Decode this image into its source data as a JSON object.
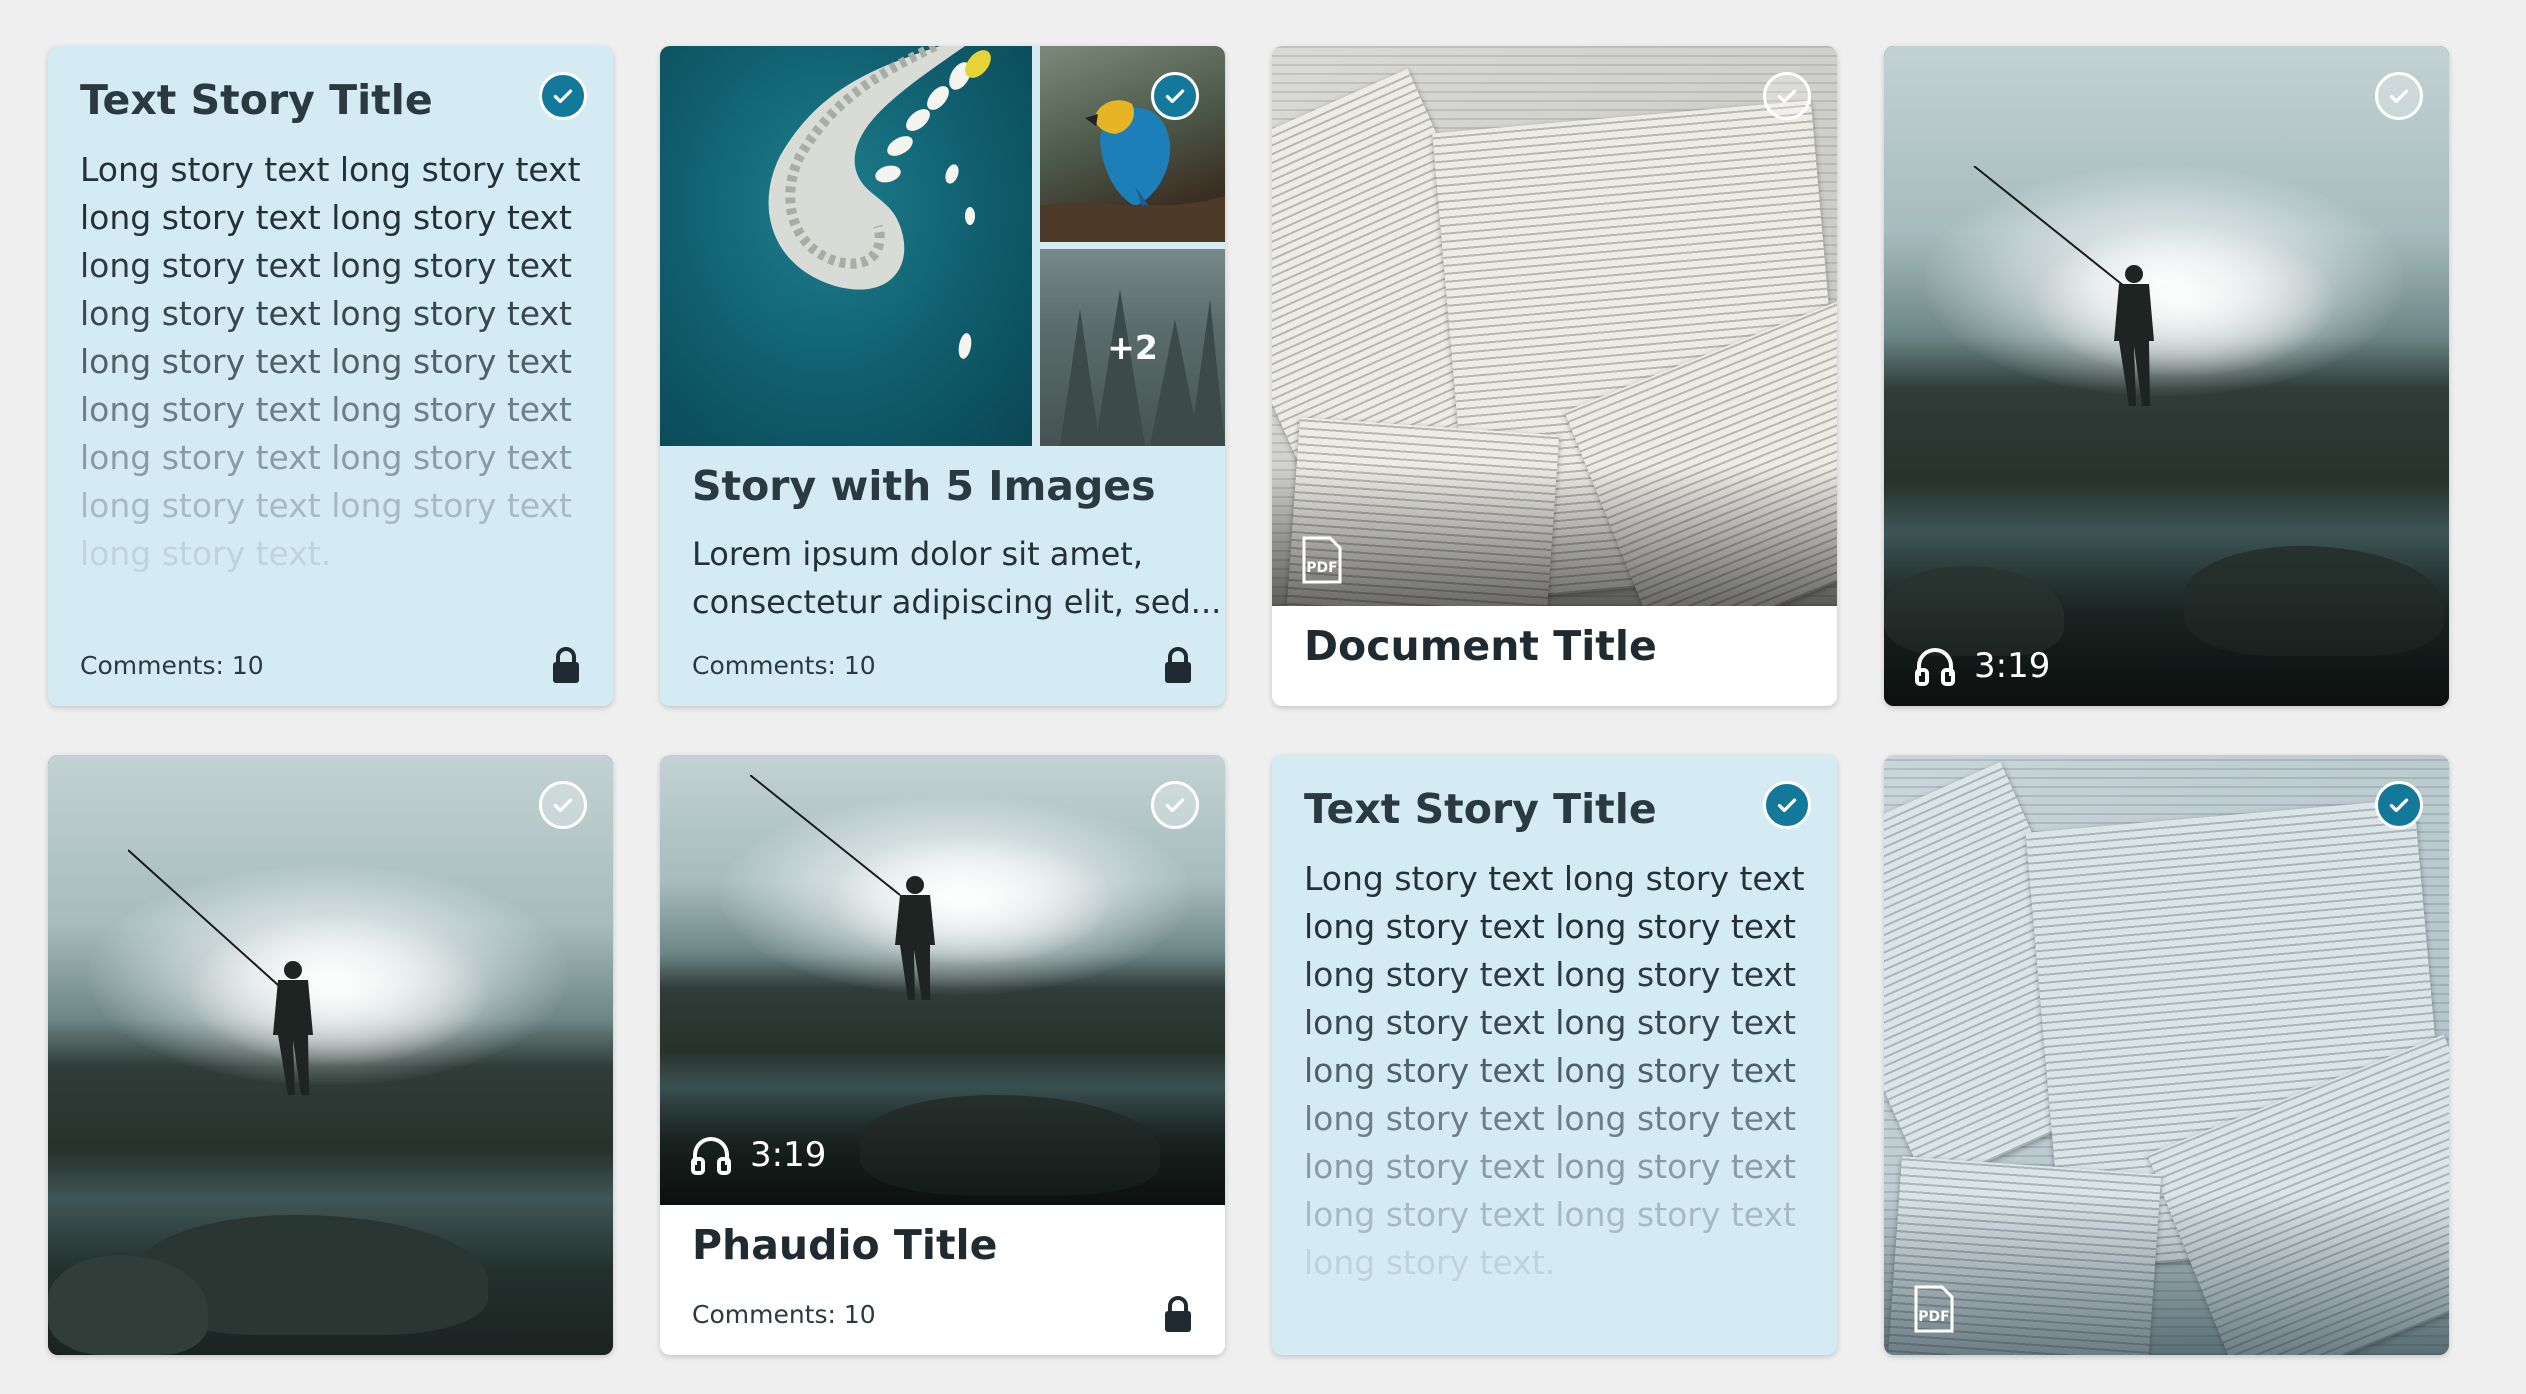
{
  "colors": {
    "accent": "#12799b",
    "card_blue": "#d4ebf4",
    "background": "#efefef"
  },
  "icons": {
    "selected": "check-circle-icon",
    "unselected": "check-circle-outline-icon",
    "lock": "lock-icon",
    "audio": "headphones-icon",
    "document": "pdf-icon"
  },
  "cards": {
    "text_story_1": {
      "title": "Text Story Title",
      "lines": [
        "Long story text long story text",
        "long story text long story text",
        "long story text long story text",
        "long story text long story text",
        "long story text long story text",
        "long story text long story text",
        "long story text long story text",
        "long story text long story text",
        "long story text."
      ],
      "comments": "Comments: 10",
      "selected": true
    },
    "image_story": {
      "title": "Story with 5 Images",
      "excerpt_lines": [
        "Lorem ipsum dolor sit amet,",
        "consectetur adipiscing elit, sed..."
      ],
      "more_images": "+2",
      "comments": "Comments: 10",
      "selected": true
    },
    "document": {
      "title": "Document Title",
      "badge": "PDF",
      "selected": false
    },
    "audio_1": {
      "duration": "3:19",
      "selected": false
    },
    "photo": {
      "selected": false
    },
    "phaudio": {
      "title": "Phaudio Title",
      "duration": "3:19",
      "comments": "Comments: 10",
      "selected": false
    },
    "text_story_2": {
      "title": "Text Story Title",
      "lines": [
        "Long story text long story text",
        "long story text long story text",
        "long story text long story text",
        "long story text long story text",
        "long story text long story text",
        "long story text long story text",
        "long story text long story text",
        "long story text long story text",
        "long story text."
      ],
      "selected": true
    },
    "document_2": {
      "badge": "PDF",
      "selected": true
    }
  }
}
